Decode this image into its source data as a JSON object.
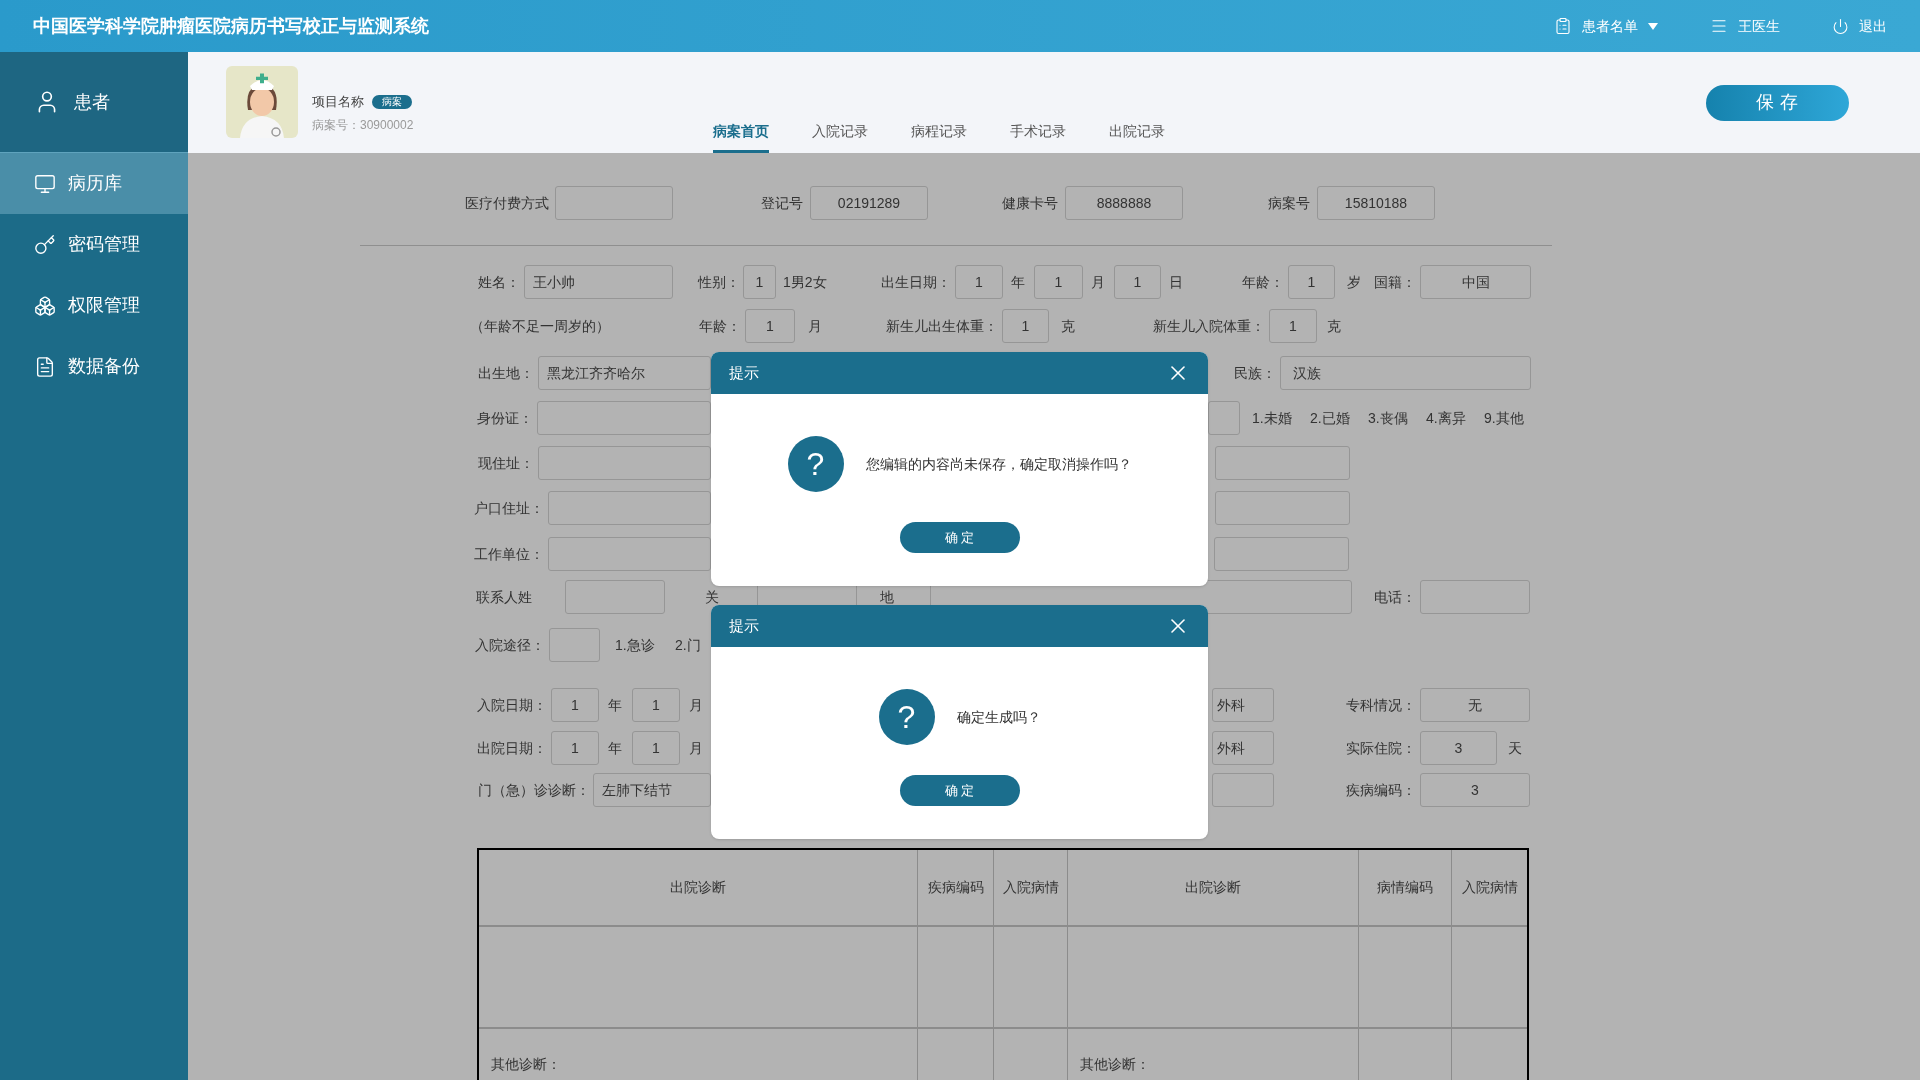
{
  "header": {
    "title": "中国医学科学院肿瘤医院病历书写校正与监测系统",
    "nav": [
      {
        "label": "患者名单"
      },
      {
        "label": "王医生"
      },
      {
        "label": "退出"
      }
    ]
  },
  "sidebar": {
    "header": {
      "label": "患者"
    },
    "items": [
      {
        "label": "病历库",
        "selected": true
      },
      {
        "label": "密码管理",
        "selected": false
      },
      {
        "label": "权限管理",
        "selected": false
      },
      {
        "label": "数据备份",
        "selected": false
      }
    ]
  },
  "profile": {
    "name": "项目名称",
    "badge": "病案",
    "record_number": "病案号：30900002"
  },
  "tabs": [
    {
      "label": "病案首页",
      "selected": true
    },
    {
      "label": "入院记录",
      "selected": false
    },
    {
      "label": "病程记录",
      "selected": false
    },
    {
      "label": "手术记录",
      "selected": false
    },
    {
      "label": "出院记录",
      "selected": false
    }
  ],
  "save_button": "保存",
  "form": {
    "lines": [
      {
        "items": [
          {
            "kind": "label",
            "text": "医疗付费方式"
          },
          {
            "kind": "field"
          },
          {
            "kind": "label",
            "text": "登记号"
          },
          {
            "kind": "field",
            "value": "02191289"
          },
          {
            "kind": "label",
            "text": "健康卡号"
          },
          {
            "kind": "field",
            "value": "8888888"
          },
          {
            "kind": "label",
            "text": "病案号"
          },
          {
            "kind": "field",
            "value": "15810188"
          }
        ]
      },
      {
        "items": [
          {
            "kind": "label",
            "text": "姓名："
          },
          {
            "kind": "field",
            "value": "王小帅"
          },
          {
            "kind": "label",
            "text": "性别："
          },
          {
            "kind": "field",
            "value": "1"
          },
          {
            "kind": "text",
            "text": "1男2女"
          },
          {
            "kind": "label",
            "text": "出生日期："
          },
          {
            "kind": "field",
            "value": "1"
          },
          {
            "kind": "text",
            "text": "年"
          },
          {
            "kind": "field",
            "value": "1"
          },
          {
            "kind": "text",
            "text": "月"
          },
          {
            "kind": "field",
            "value": "1"
          },
          {
            "kind": "text",
            "text": "日"
          },
          {
            "kind": "label",
            "text": "年龄："
          },
          {
            "kind": "field",
            "value": "1"
          },
          {
            "kind": "text",
            "text": "岁"
          },
          {
            "kind": "label",
            "text": "国籍："
          },
          {
            "kind": "field",
            "value": "中国"
          }
        ]
      },
      {
        "items": [
          {
            "kind": "text",
            "text": "（年龄不足一周岁的）"
          },
          {
            "kind": "label",
            "text": "年龄："
          },
          {
            "kind": "field",
            "value": "1"
          },
          {
            "kind": "text",
            "text": "月"
          },
          {
            "kind": "label",
            "text": "新生儿出生体重："
          },
          {
            "kind": "field",
            "value": "1"
          },
          {
            "kind": "text",
            "text": "克"
          },
          {
            "kind": "label",
            "text": "新生儿入院体重："
          },
          {
            "kind": "field",
            "value": "1"
          },
          {
            "kind": "text",
            "text": "克"
          }
        ]
      },
      {
        "items": [
          {
            "kind": "label",
            "text": "出生地："
          },
          {
            "kind": "field",
            "value": "黑龙江齐齐哈尔"
          },
          {
            "kind": "label",
            "text": "民族："
          },
          {
            "kind": "field",
            "value": "汉族"
          }
        ]
      },
      {
        "items": [
          {
            "kind": "label",
            "text": "身份证："
          },
          {
            "kind": "field"
          },
          {
            "kind": "field"
          },
          {
            "kind": "text",
            "text": "1.未婚"
          },
          {
            "kind": "text",
            "text": "2.已婚"
          },
          {
            "kind": "text",
            "text": "3.丧偶"
          },
          {
            "kind": "text",
            "text": "4.离异"
          },
          {
            "kind": "text",
            "text": "9.其他"
          }
        ]
      },
      {
        "items": [
          {
            "kind": "label",
            "text": "现住址："
          },
          {
            "kind": "field"
          },
          {
            "kind": "field"
          }
        ]
      },
      {
        "items": [
          {
            "kind": "label",
            "text": "户口住址："
          },
          {
            "kind": "field"
          },
          {
            "kind": "field"
          }
        ]
      },
      {
        "items": [
          {
            "kind": "label",
            "text": "工作单位："
          },
          {
            "kind": "field"
          },
          {
            "kind": "field"
          }
        ]
      },
      {
        "items": [
          {
            "kind": "text",
            "text": "联系人姓"
          },
          {
            "kind": "field"
          },
          {
            "kind": "text",
            "text": "关"
          },
          {
            "kind": "field"
          },
          {
            "kind": "text",
            "text": "地"
          },
          {
            "kind": "field"
          },
          {
            "kind": "label",
            "text": "电话："
          },
          {
            "kind": "field"
          }
        ]
      },
      {
        "items": [
          {
            "kind": "label",
            "text": "入院途径："
          },
          {
            "kind": "field"
          },
          {
            "kind": "text",
            "text": "1.急诊"
          },
          {
            "kind": "text",
            "text": "2.门"
          }
        ]
      },
      {
        "items": [
          {
            "kind": "label",
            "text": "入院日期："
          },
          {
            "kind": "field",
            "value": "1"
          },
          {
            "kind": "text",
            "text": "年"
          },
          {
            "kind": "field",
            "value": "1"
          },
          {
            "kind": "text",
            "text": "月"
          },
          {
            "kind": "field",
            "value": "外科"
          },
          {
            "kind": "label",
            "text": "专科情况："
          },
          {
            "kind": "field",
            "value": "无"
          }
        ]
      },
      {
        "items": [
          {
            "kind": "label",
            "text": "出院日期："
          },
          {
            "kind": "field",
            "value": "1"
          },
          {
            "kind": "text",
            "text": "年"
          },
          {
            "kind": "field",
            "value": "1"
          },
          {
            "kind": "text",
            "text": "月"
          },
          {
            "kind": "field",
            "value": "外科"
          },
          {
            "kind": "label",
            "text": "实际住院："
          },
          {
            "kind": "field",
            "value": "3"
          },
          {
            "kind": "text",
            "text": "天"
          }
        ]
      },
      {
        "items": [
          {
            "kind": "label",
            "text": "门（急）诊诊断："
          },
          {
            "kind": "field",
            "value": "左肺下结节"
          },
          {
            "kind": "field"
          },
          {
            "kind": "label",
            "text": "疾病编码："
          },
          {
            "kind": "field",
            "value": "3"
          }
        ]
      }
    ]
  },
  "table": {
    "columns": [
      "出院诊断",
      "疾病编码",
      "入院病情",
      "出院诊断",
      "病情编码",
      "入院病情"
    ],
    "other_diagnosis": [
      "其他诊断：",
      "其他诊断："
    ]
  },
  "dialogs": [
    {
      "title": "提示",
      "icon": "?",
      "message": "您编辑的内容尚未保存，确定取消操作吗？",
      "button": "确定"
    },
    {
      "title": "提示",
      "icon": "?",
      "message": "确定生成吗？",
      "button": "确定"
    }
  ]
}
